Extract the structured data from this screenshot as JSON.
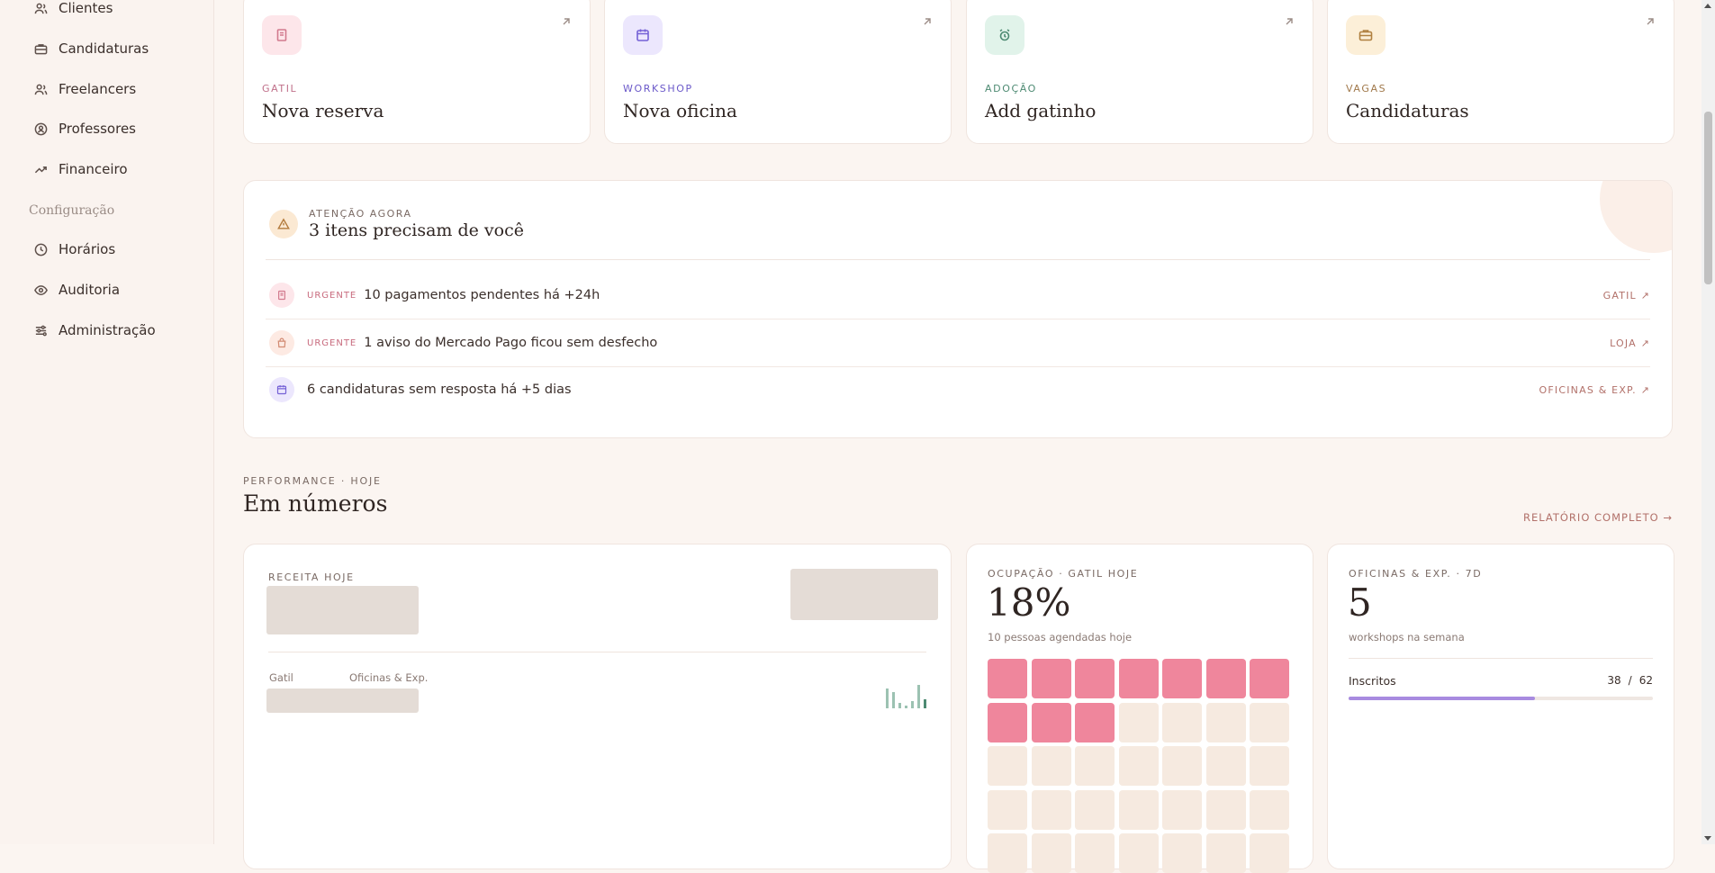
{
  "sidebar": {
    "items": [
      {
        "label": "Clientes",
        "icon": "users-icon"
      },
      {
        "label": "Candidaturas",
        "icon": "briefcase-icon"
      },
      {
        "label": "Freelancers",
        "icon": "users-icon"
      },
      {
        "label": "Professores",
        "icon": "badge-icon"
      },
      {
        "label": "Financeiro",
        "icon": "trending-up-icon"
      }
    ],
    "config_section": "Configuração",
    "config_items": [
      {
        "label": "Horários",
        "icon": "clock-icon"
      },
      {
        "label": "Auditoria",
        "icon": "eye-icon"
      },
      {
        "label": "Administração",
        "icon": "sliders-icon"
      }
    ]
  },
  "shortcuts": [
    {
      "tag": "GATIL",
      "title": "Nova reserva",
      "icon": "receipt-icon",
      "tag_color": "#c0708a",
      "icon_bg": "#fde6ea"
    },
    {
      "tag": "WORKSHOP",
      "title": "Nova oficina",
      "icon": "calendar-icon",
      "tag_color": "#6b59c9",
      "icon_bg": "#ece7fd"
    },
    {
      "tag": "ADOÇÃO",
      "title": "Add gatinho",
      "icon": "alarm-clock-icon",
      "tag_color": "#4d8a72",
      "icon_bg": "#e1f3ea"
    },
    {
      "tag": "VAGAS",
      "title": "Candidaturas",
      "icon": "briefcase-icon",
      "tag_color": "#a0784a",
      "icon_bg": "#fcefd8"
    }
  ],
  "attention": {
    "eyebrow": "ATENÇÃO AGORA",
    "title": "3 itens precisam de você",
    "items": [
      {
        "urgent": "URGENTE",
        "text": "10 pagamentos pendentes há +24h",
        "link": "GATIL ↗"
      },
      {
        "urgent": "URGENTE",
        "text": "1 aviso do Mercado Pago ficou sem desfecho",
        "link": "LOJA ↗"
      },
      {
        "urgent": "",
        "text": "6 candidaturas sem resposta há +5 dias",
        "link": "OFICINAS & EXP. ↗"
      }
    ]
  },
  "performance": {
    "eyebrow": "PERFORMANCE · HOJE",
    "title": "Em números",
    "report_link": "RELATÓRIO COMPLETO →"
  },
  "revenue_card": {
    "eyebrow": "RECEITA HOJE",
    "col_a": "Gatil",
    "col_b": "Oficinas & Exp."
  },
  "occupancy_card": {
    "eyebrow": "OCUPAÇÃO · GATIL HOJE",
    "value": "18%",
    "sub": "10 pessoas agendadas hoje",
    "filled_cells": 10,
    "colors": {
      "filled": "#ef869c",
      "empty": "#f6eae0"
    }
  },
  "workshops_card": {
    "eyebrow": "OFICINAS & EXP. · 7D",
    "value": "5",
    "sub": "workshops na semana",
    "enrolled_label": "Inscritos",
    "enrolled": "38",
    "separator": "/",
    "capacity": "62",
    "fill_fraction": 0.613,
    "bar_color": "#a88be0"
  }
}
